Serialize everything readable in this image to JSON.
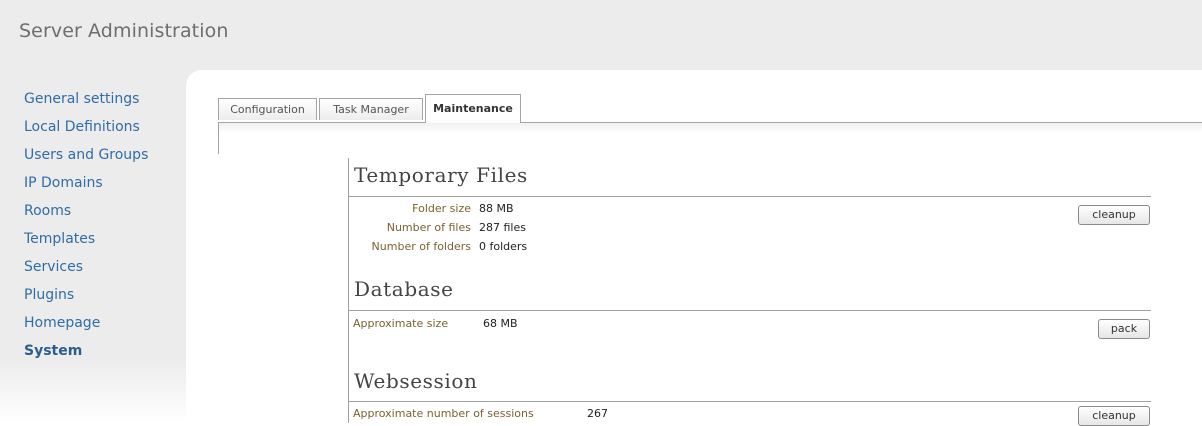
{
  "header": {
    "title": "Server Administration"
  },
  "sidebar": {
    "items": [
      {
        "label": "General settings"
      },
      {
        "label": "Local Definitions"
      },
      {
        "label": "Users and Groups"
      },
      {
        "label": "IP Domains"
      },
      {
        "label": "Rooms"
      },
      {
        "label": "Templates"
      },
      {
        "label": "Services"
      },
      {
        "label": "Plugins"
      },
      {
        "label": "Homepage"
      },
      {
        "label": "System",
        "active": true
      }
    ]
  },
  "tabs": [
    {
      "label": "Configuration"
    },
    {
      "label": "Task Manager"
    },
    {
      "label": "Maintenance",
      "active": true
    }
  ],
  "sections": {
    "temp_files": {
      "title": "Temporary Files",
      "folder_size_label": "Folder size",
      "folder_size_value": "88 MB",
      "num_files_label": "Number of files",
      "num_files_value": "287 files",
      "num_folders_label": "Number of folders",
      "num_folders_value": "0 folders",
      "button": "cleanup"
    },
    "database": {
      "title": "Database",
      "size_label": "Approximate size",
      "size_value": "68 MB",
      "button": "pack"
    },
    "websession": {
      "title": "Websession",
      "sessions_label": "Approximate number of sessions",
      "sessions_value": "267",
      "button": "cleanup"
    }
  }
}
